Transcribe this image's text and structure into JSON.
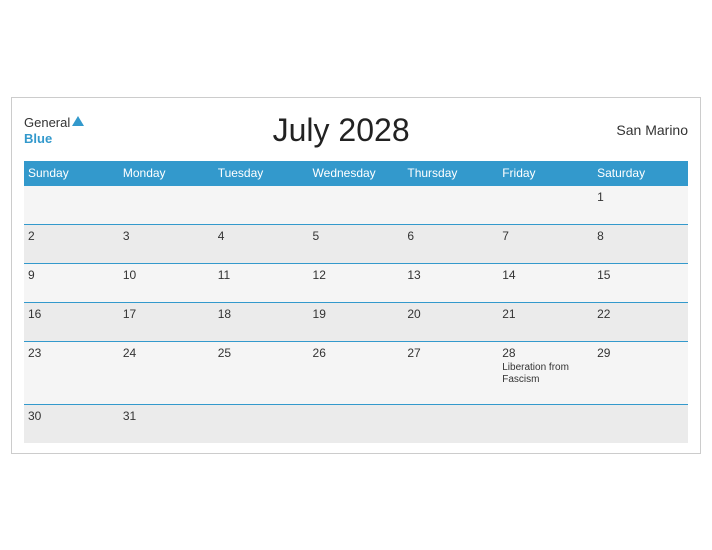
{
  "header": {
    "logo_general": "General",
    "logo_blue": "Blue",
    "month_title": "July 2028",
    "country": "San Marino"
  },
  "weekdays": [
    "Sunday",
    "Monday",
    "Tuesday",
    "Wednesday",
    "Thursday",
    "Friday",
    "Saturday"
  ],
  "weeks": [
    [
      {
        "day": "",
        "event": ""
      },
      {
        "day": "",
        "event": ""
      },
      {
        "day": "",
        "event": ""
      },
      {
        "day": "",
        "event": ""
      },
      {
        "day": "",
        "event": ""
      },
      {
        "day": "",
        "event": ""
      },
      {
        "day": "1",
        "event": ""
      }
    ],
    [
      {
        "day": "2",
        "event": ""
      },
      {
        "day": "3",
        "event": ""
      },
      {
        "day": "4",
        "event": ""
      },
      {
        "day": "5",
        "event": ""
      },
      {
        "day": "6",
        "event": ""
      },
      {
        "day": "7",
        "event": ""
      },
      {
        "day": "8",
        "event": ""
      }
    ],
    [
      {
        "day": "9",
        "event": ""
      },
      {
        "day": "10",
        "event": ""
      },
      {
        "day": "11",
        "event": ""
      },
      {
        "day": "12",
        "event": ""
      },
      {
        "day": "13",
        "event": ""
      },
      {
        "day": "14",
        "event": ""
      },
      {
        "day": "15",
        "event": ""
      }
    ],
    [
      {
        "day": "16",
        "event": ""
      },
      {
        "day": "17",
        "event": ""
      },
      {
        "day": "18",
        "event": ""
      },
      {
        "day": "19",
        "event": ""
      },
      {
        "day": "20",
        "event": ""
      },
      {
        "day": "21",
        "event": ""
      },
      {
        "day": "22",
        "event": ""
      }
    ],
    [
      {
        "day": "23",
        "event": ""
      },
      {
        "day": "24",
        "event": ""
      },
      {
        "day": "25",
        "event": ""
      },
      {
        "day": "26",
        "event": ""
      },
      {
        "day": "27",
        "event": ""
      },
      {
        "day": "28",
        "event": "Liberation from Fascism"
      },
      {
        "day": "29",
        "event": ""
      }
    ],
    [
      {
        "day": "30",
        "event": ""
      },
      {
        "day": "31",
        "event": ""
      },
      {
        "day": "",
        "event": ""
      },
      {
        "day": "",
        "event": ""
      },
      {
        "day": "",
        "event": ""
      },
      {
        "day": "",
        "event": ""
      },
      {
        "day": "",
        "event": ""
      }
    ]
  ]
}
